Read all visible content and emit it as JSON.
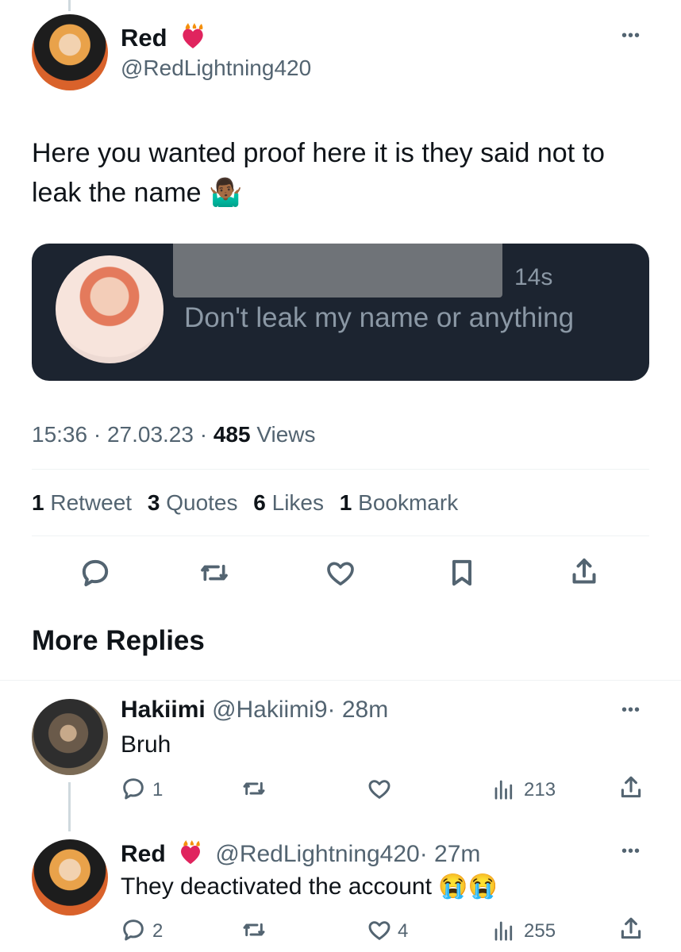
{
  "tweet": {
    "author_name": "Red",
    "author_handle": "@RedLightning420",
    "text": "Here you wanted proof here it is they said not to leak the name 🤷🏾‍♂️",
    "embedded": {
      "time": "14s",
      "message": "Don't leak my name or anything"
    },
    "timestamp": "15:36 · 27.03.23 ·",
    "views_count": "485",
    "views_label": "Views",
    "stats": {
      "retweets_count": "1",
      "retweets_label": "Retweet",
      "quotes_count": "3",
      "quotes_label": "Quotes",
      "likes_count": "6",
      "likes_label": "Likes",
      "bookmarks_count": "1",
      "bookmarks_label": "Bookmark"
    }
  },
  "more_replies_heading": "More Replies",
  "replies": [
    {
      "name": "Hakiimi",
      "handle": "@Hakiimi9",
      "time": "· 28m",
      "text": "Bruh",
      "reply_count": "1",
      "retweet_count": "",
      "like_count": "",
      "view_count": "213"
    },
    {
      "name": "Red",
      "handle": "@RedLightning420",
      "time": "· 27m",
      "text": "They deactivated the account 😭😭",
      "reply_count": "2",
      "retweet_count": "",
      "like_count": "4",
      "view_count": "255"
    }
  ],
  "icons": {
    "reply": "speech-bubble-icon",
    "retweet": "retweet-arrows-icon",
    "like": "heart-icon",
    "bookmark": "bookmark-icon",
    "share": "share-upload-icon",
    "views": "bar-chart-icon",
    "more": "ellipsis-icon",
    "badge": "flaming-heart-emoji"
  },
  "colors": {
    "text": "#0f1419",
    "muted": "#536471",
    "divider": "#eff3f4",
    "embed_bg": "#1c2430",
    "heart_badge": "#e0245e"
  }
}
